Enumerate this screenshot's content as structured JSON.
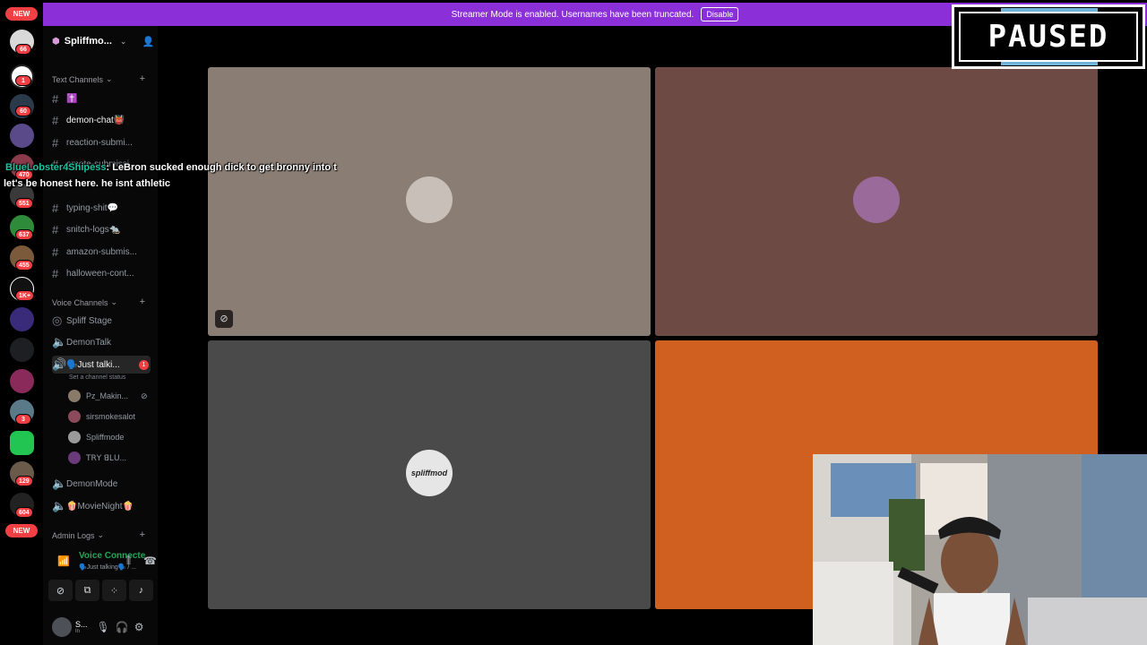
{
  "banner": {
    "text": "Streamer Mode is enabled. Usernames have been truncated.",
    "button": "Disable"
  },
  "rail": {
    "new_top": "NEW",
    "new_bottom": "NEW",
    "badges": [
      "66",
      "1",
      "60",
      "470",
      "551",
      "637",
      "455",
      "1K+",
      "3",
      "129",
      "604"
    ]
  },
  "server": {
    "name": "Spliffmo..."
  },
  "text_channels": {
    "label": "Text Channels",
    "items": [
      {
        "name": "✝️"
      },
      {
        "name": "demon-chat👹"
      },
      {
        "name": "reaction-submi..."
      },
      {
        "name": "emote-submissi..."
      },
      {
        "name": "typing-shit💬"
      },
      {
        "name": "snitch-logs🐀"
      },
      {
        "name": "amazon-submis..."
      },
      {
        "name": "halloween-cont..."
      }
    ]
  },
  "voice_channels": {
    "label": "Voice Channels",
    "items": [
      {
        "name": "Spliff Stage"
      },
      {
        "name": "DemonTalk"
      },
      {
        "name": "🗣️Just talki...",
        "badge": "1"
      },
      {
        "name": "DemonMode"
      },
      {
        "name": "🍿MovieNight🍿"
      }
    ],
    "status": "Set a channel status",
    "users": [
      "Pz_Makin...",
      "sirsmokesalot",
      "Spliffmode",
      "ꓔꓣꓬ ꓭꓡꓴ..."
    ]
  },
  "admin_logs": {
    "label": "Admin Logs"
  },
  "voice_panel": {
    "title": "Voice Connecte",
    "subtitle": "🗣️Just talking🗣️ / ..."
  },
  "user_panel": {
    "name": "S...",
    "status": "In"
  },
  "overlay": {
    "line1_name": "BlueLobster4Shipess",
    "line1_text": ": LeBron sucked enough dick to get bronny into t",
    "line2_text": "let's be honest here. he isnt athletic"
  },
  "tiles": {
    "colors": [
      "#8a7d74",
      "#6e4a44",
      "#4a4a4a",
      "#cf6020"
    ],
    "avatar3_text": "spliffmod"
  },
  "paused": {
    "text": "PAUSED"
  }
}
